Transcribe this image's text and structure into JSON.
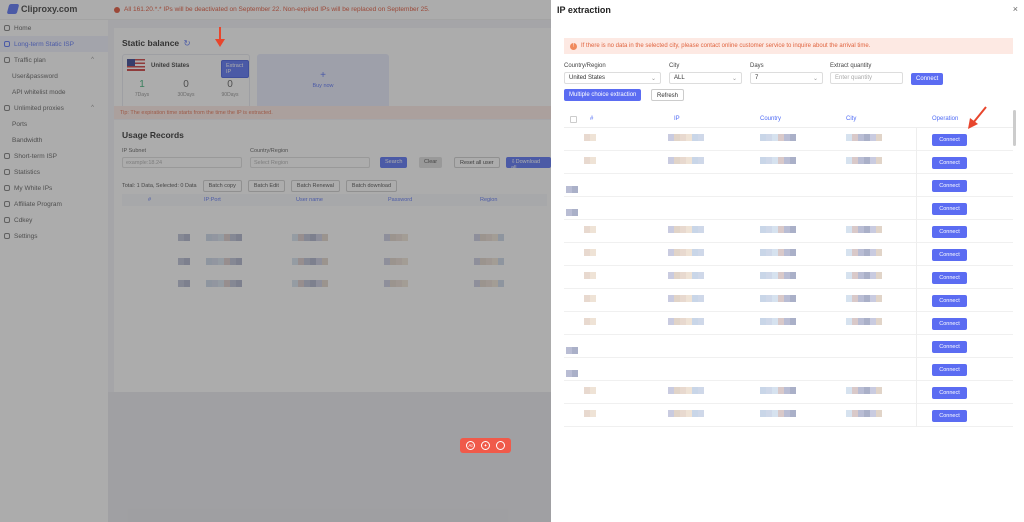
{
  "app": {
    "brand": "Cliproxy.com",
    "notice": "All 161.20.*.* IPs will be deactivated on September 22. Non-expired IPs will be replaced on September 25.",
    "sidebar": [
      {
        "label": "Home",
        "icon": "home-icon",
        "active": false,
        "sub": false
      },
      {
        "label": "Long-term Static ISP",
        "icon": "location-icon",
        "active": true,
        "sub": false
      },
      {
        "label": "Traffic plan",
        "icon": "traffic-icon",
        "active": false,
        "sub": false,
        "caret": "^"
      },
      {
        "label": "User&password",
        "icon": "",
        "active": false,
        "sub": true
      },
      {
        "label": "API whitelist mode",
        "icon": "",
        "active": false,
        "sub": true
      },
      {
        "label": "Unlimited proxies",
        "icon": "infinity-icon",
        "active": false,
        "sub": false,
        "caret": "^"
      },
      {
        "label": "Ports",
        "icon": "",
        "active": false,
        "sub": true
      },
      {
        "label": "Bandwidth",
        "icon": "",
        "active": false,
        "sub": true
      },
      {
        "label": "Short-term ISP",
        "icon": "clock-icon",
        "active": false,
        "sub": false
      },
      {
        "label": "Statistics",
        "icon": "chart-icon",
        "active": false,
        "sub": false
      },
      {
        "label": "My White IPs",
        "icon": "list-icon",
        "active": false,
        "sub": false
      },
      {
        "label": "Affiliate Program",
        "icon": "affiliate-icon",
        "active": false,
        "sub": false
      },
      {
        "label": "Cdkey",
        "icon": "key-icon",
        "active": false,
        "sub": false
      },
      {
        "label": "Settings",
        "icon": "gear-icon",
        "active": false,
        "sub": false
      }
    ],
    "static_balance": {
      "title": "Static balance",
      "refresh_glyph": "↻",
      "country": "United States",
      "extract_label": "Extract IP",
      "stats": [
        {
          "value": "1",
          "label": "7Days"
        },
        {
          "value": "0",
          "label": "30Days"
        },
        {
          "value": "0",
          "label": "90Days"
        }
      ],
      "buy_plus": "+",
      "buy_label": "Buy now"
    },
    "tip": "Tip: The expiration time starts from the time the IP is extracted.",
    "records": {
      "title": "Usage Records",
      "subnet_label": "IP Subnet",
      "subnet_placeholder": "example:18.24",
      "region_label": "Country/Region",
      "region_placeholder": "Select Region",
      "search": "Search",
      "clear": "Clear",
      "reset_user": "Reset all user",
      "download_all": "⇩Download all",
      "summary": "Total: 1 Data, Selected: 0 Data",
      "batch_copy": "Batch copy",
      "batch_edit": "Batch Edit",
      "batch_renewal": "Batch Renewal",
      "batch_download": "Batch download",
      "columns": [
        "#",
        "IP:Port",
        "User name",
        "Password",
        "Region"
      ]
    }
  },
  "drawer": {
    "title": "IP extraction",
    "close": "×",
    "alert": "If there is no data in the selected city, please contact online customer service to inquire about the arrival time.",
    "filters": {
      "country_label": "Country/Region",
      "country_value": "United States",
      "city_label": "City",
      "city_value": "ALL",
      "days_label": "Days",
      "days_value": "7",
      "qty_label": "Extract quantity",
      "qty_placeholder": "Enter quantity",
      "connect": "Connect"
    },
    "multi_choice": "Multiple choice extraction",
    "refresh": "Refresh",
    "columns": [
      "#",
      "IP",
      "Country",
      "City",
      "Operation"
    ],
    "row_action": "Connect",
    "row_count": 13
  },
  "colors": {
    "accent": "#5b6cf2",
    "alert_bg": "#fde9e3",
    "alert_text": "#e0643f",
    "annotation_arrow": "#e8452c"
  }
}
